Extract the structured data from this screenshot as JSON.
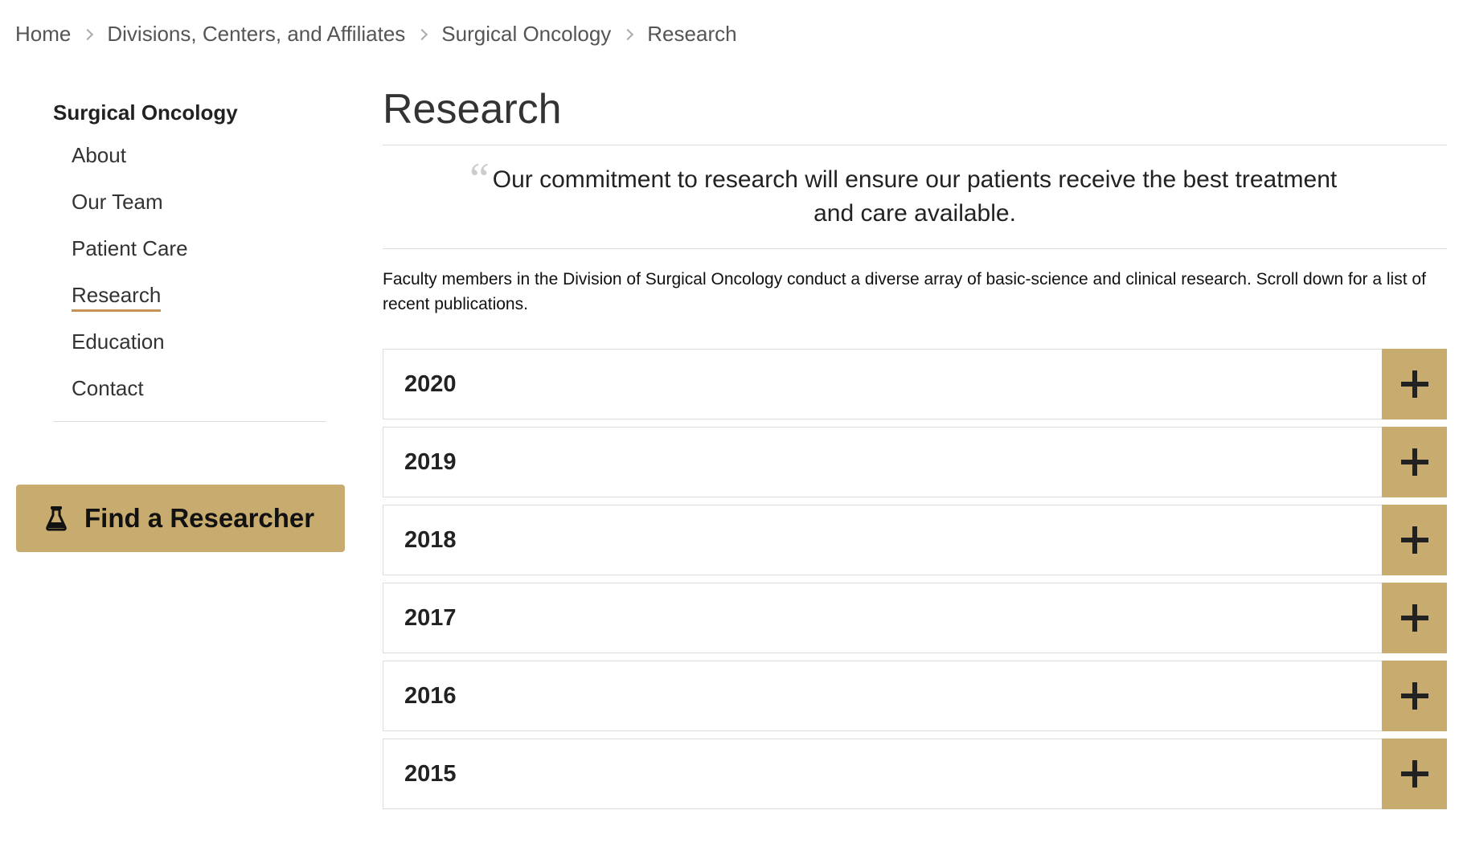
{
  "breadcrumb": {
    "items": [
      "Home",
      "Divisions, Centers, and Affiliates",
      "Surgical Oncology",
      "Research"
    ]
  },
  "sidebar": {
    "title": "Surgical Oncology",
    "items": [
      {
        "label": "About"
      },
      {
        "label": "Our Team"
      },
      {
        "label": "Patient Care"
      },
      {
        "label": "Research",
        "active": true
      },
      {
        "label": "Education"
      },
      {
        "label": "Contact"
      }
    ],
    "find_button": {
      "label": "Find a Researcher",
      "icon": "flask-icon"
    }
  },
  "main": {
    "title": "Research",
    "quote": "Our commitment to research will ensure our patients receive the best treatment and care available.",
    "intro": "Faculty members in the Division of Surgical Oncology conduct a diverse array of basic-science and clinical research. Scroll down for a list of recent publications.",
    "years": [
      "2020",
      "2019",
      "2018",
      "2017",
      "2016",
      "2015"
    ]
  },
  "colors": {
    "accent": "#c8ab6e",
    "active_underline": "#c79355",
    "text": "#333333",
    "divider": "#dddddd"
  }
}
